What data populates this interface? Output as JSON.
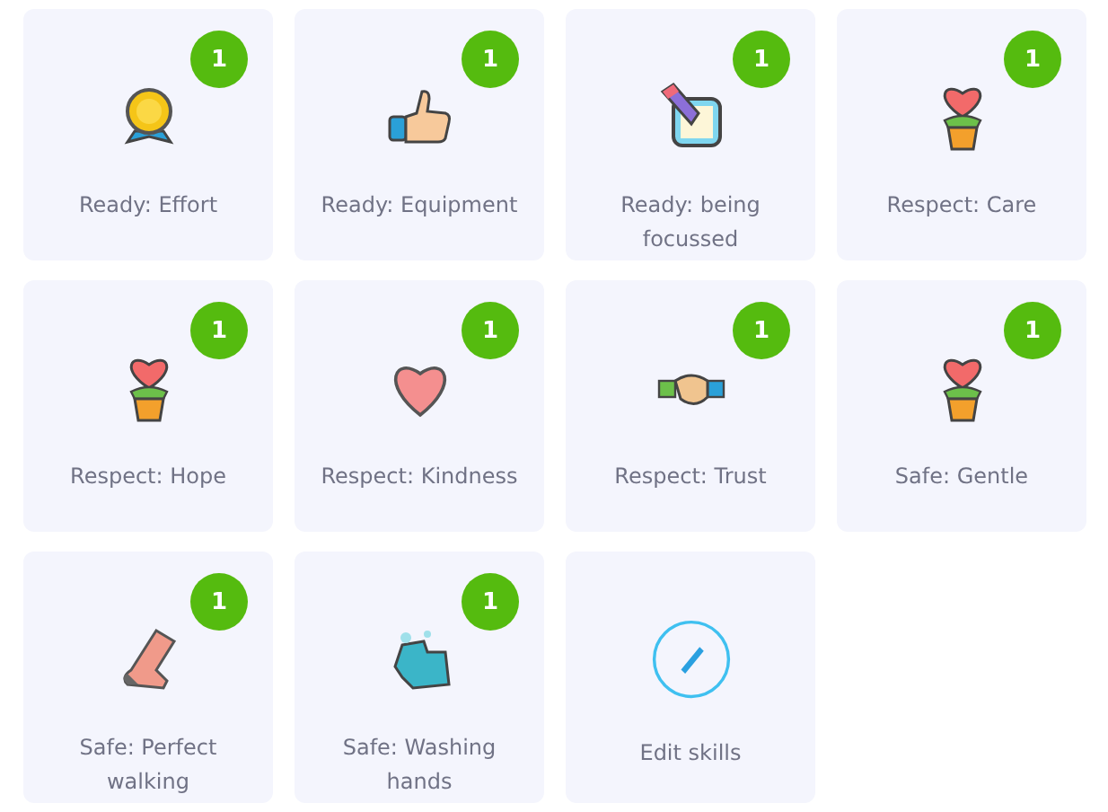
{
  "skills": [
    {
      "kind": "medal",
      "label": "Ready: Effort",
      "badge": "1"
    },
    {
      "kind": "thumb",
      "label": "Ready: Equipment",
      "badge": "1"
    },
    {
      "kind": "note",
      "label": "Ready: being focussed",
      "badge": "1"
    },
    {
      "kind": "plant",
      "label": "Respect: Care",
      "badge": "1"
    },
    {
      "kind": "plant",
      "label": "Respect: Hope",
      "badge": "1"
    },
    {
      "kind": "heart",
      "label": "Respect: Kindness",
      "badge": "1"
    },
    {
      "kind": "handshake",
      "label": "Respect: Trust",
      "badge": "1"
    },
    {
      "kind": "plant",
      "label": "Safe: Gentle",
      "badge": "1"
    },
    {
      "kind": "foot",
      "label": "Safe: Perfect walking",
      "badge": "1"
    },
    {
      "kind": "hand",
      "label": "Safe: Washing hands",
      "badge": "1"
    }
  ],
  "edit": {
    "label": "Edit skills"
  }
}
